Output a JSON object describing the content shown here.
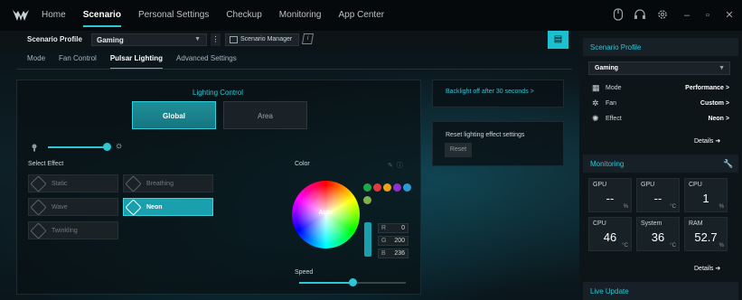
{
  "nav": {
    "items": [
      "Home",
      "Scenario",
      "Personal Settings",
      "Checkup",
      "Monitoring",
      "App Center"
    ],
    "active": "Scenario"
  },
  "profile": {
    "label": "Scenario Profile",
    "value": "Gaming",
    "manager_label": "Scenario Manager",
    "info": "i"
  },
  "subtabs": {
    "items": [
      "Mode",
      "Fan Control",
      "Pulsar Lighting",
      "Advanced Settings"
    ],
    "active": "Pulsar Lighting"
  },
  "lighting": {
    "title": "Lighting Control",
    "global_label": "Global",
    "area_label": "Area",
    "brightness": 0.95,
    "select_effect_label": "Select Effect",
    "effects": [
      "Static",
      "Breathing",
      "Wave",
      "Neon",
      "Twinkling"
    ],
    "selected_effect": "Neon",
    "color_label": "Color",
    "wheel_label": "Auto",
    "swatches": [
      "#1ea84a",
      "#e23a3a",
      "#e9a21a",
      "#8e2fd0",
      "#2b9bd8",
      "#7db34a"
    ],
    "rgb": {
      "r_key": "R",
      "r": "0",
      "g_key": "G",
      "g": "200",
      "b_key": "B",
      "b": "236"
    },
    "speed_label": "Speed",
    "speed": 0.5
  },
  "backlight": {
    "label": "Backlight off after 30 seconds >"
  },
  "reset": {
    "label": "Reset lighting effect settings",
    "button": "Reset"
  },
  "right": {
    "profile_title": "Scenario Profile",
    "profile_value": "Gaming",
    "rows": [
      {
        "key": "Mode",
        "value": "Performance >"
      },
      {
        "key": "Fan",
        "value": "Custom >"
      },
      {
        "key": "Effect",
        "value": "Neon >"
      }
    ],
    "details": "Details",
    "monitoring_title": "Monitoring",
    "tiles": [
      {
        "k": "GPU",
        "v": "--",
        "u": "%"
      },
      {
        "k": "GPU",
        "v": "--",
        "u": "°C"
      },
      {
        "k": "CPU",
        "v": "1",
        "u": "%"
      },
      {
        "k": "CPU",
        "v": "46",
        "u": "°C"
      },
      {
        "k": "System",
        "v": "36",
        "u": "°C"
      },
      {
        "k": "RAM",
        "v": "52.7",
        "u": "%"
      }
    ],
    "details2": "Details",
    "live_update": "Live Update"
  }
}
